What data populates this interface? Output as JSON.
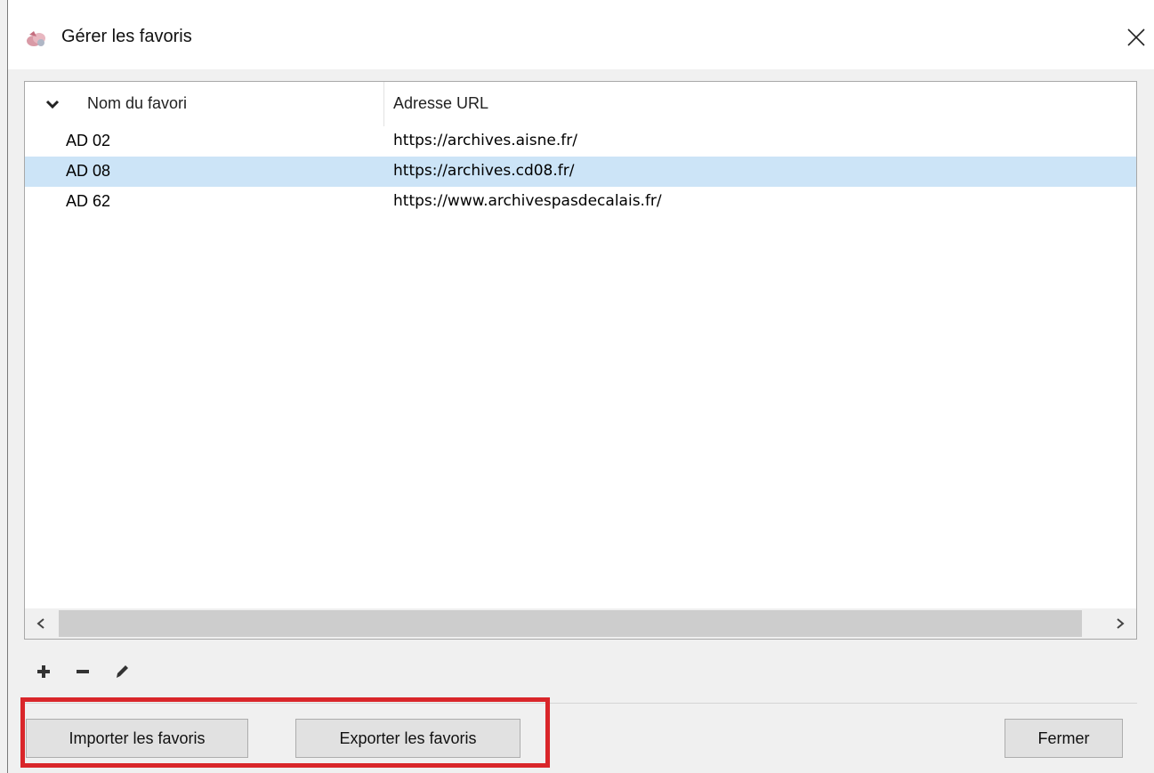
{
  "window": {
    "title": "Gérer les favoris"
  },
  "table": {
    "columns": [
      "Nom du favori",
      "Adresse URL"
    ],
    "rows": [
      {
        "name": "AD 02",
        "url": "https://archives.aisne.fr/",
        "selected": false
      },
      {
        "name": "AD 08",
        "url": "https://archives.cd08.fr/",
        "selected": true
      },
      {
        "name": "AD 62",
        "url": "https://www.archivespasdecalais.fr/",
        "selected": false
      }
    ]
  },
  "toolbar": {
    "icons": [
      "plus-icon",
      "minus-icon",
      "pencil-icon"
    ]
  },
  "buttons": {
    "import_label": "Importer les favoris",
    "export_label": "Exporter les favoris",
    "close_label": "Fermer"
  },
  "colors": {
    "selection": "#cce4f7",
    "highlight_box": "#d9262a"
  }
}
